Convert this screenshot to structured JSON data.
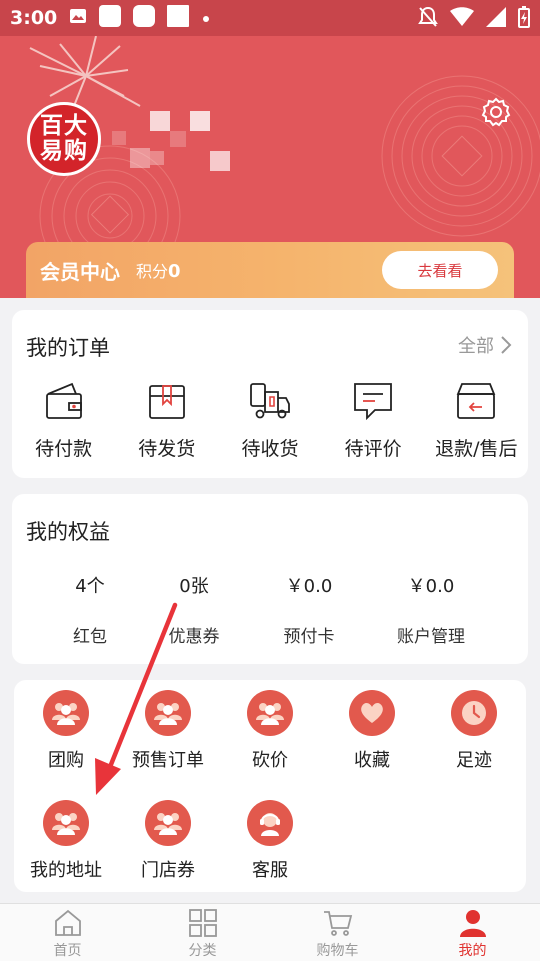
{
  "status_bar": {
    "time": "3:00"
  },
  "header": {
    "avatar_text": "百大易购",
    "settings_icon": "gear-icon",
    "member": {
      "title": "会员中心",
      "points_label": "积分",
      "points_value": "0",
      "button_label": "去看看"
    }
  },
  "orders": {
    "title": "我的订单",
    "all_label": "全部",
    "items": [
      {
        "label": "待付款",
        "icon": "wallet-icon"
      },
      {
        "label": "待发货",
        "icon": "box-icon"
      },
      {
        "label": "待收货",
        "icon": "truck-icon"
      },
      {
        "label": "待评价",
        "icon": "comment-icon"
      },
      {
        "label": "退款/售后",
        "icon": "return-box-icon"
      }
    ]
  },
  "rights": {
    "title": "我的权益",
    "items": [
      {
        "value": "4个",
        "label": "红包"
      },
      {
        "value": "0张",
        "label": "优惠券"
      },
      {
        "value": "￥0.0",
        "label": "预付卡"
      },
      {
        "value": "￥0.0",
        "label": "账户管理"
      }
    ]
  },
  "tools": {
    "items": [
      {
        "label": "团购",
        "icon": "group-icon"
      },
      {
        "label": "预售订单",
        "icon": "group-icon"
      },
      {
        "label": "砍价",
        "icon": "group-icon"
      },
      {
        "label": "收藏",
        "icon": "heart-icon"
      },
      {
        "label": "足迹",
        "icon": "clock-icon"
      },
      {
        "label": "我的地址",
        "icon": "group-icon"
      },
      {
        "label": "门店券",
        "icon": "group-icon"
      },
      {
        "label": "客服",
        "icon": "headset-icon"
      }
    ]
  },
  "tabbar": {
    "items": [
      {
        "label": "首页",
        "icon": "home-icon"
      },
      {
        "label": "分类",
        "icon": "category-icon"
      },
      {
        "label": "购物车",
        "icon": "cart-icon"
      },
      {
        "label": "我的",
        "icon": "user-icon"
      }
    ],
    "active": "我的"
  },
  "colors": {
    "brand": "#e1575b",
    "accent": "#e2594d",
    "active_tab": "#e0322f"
  }
}
